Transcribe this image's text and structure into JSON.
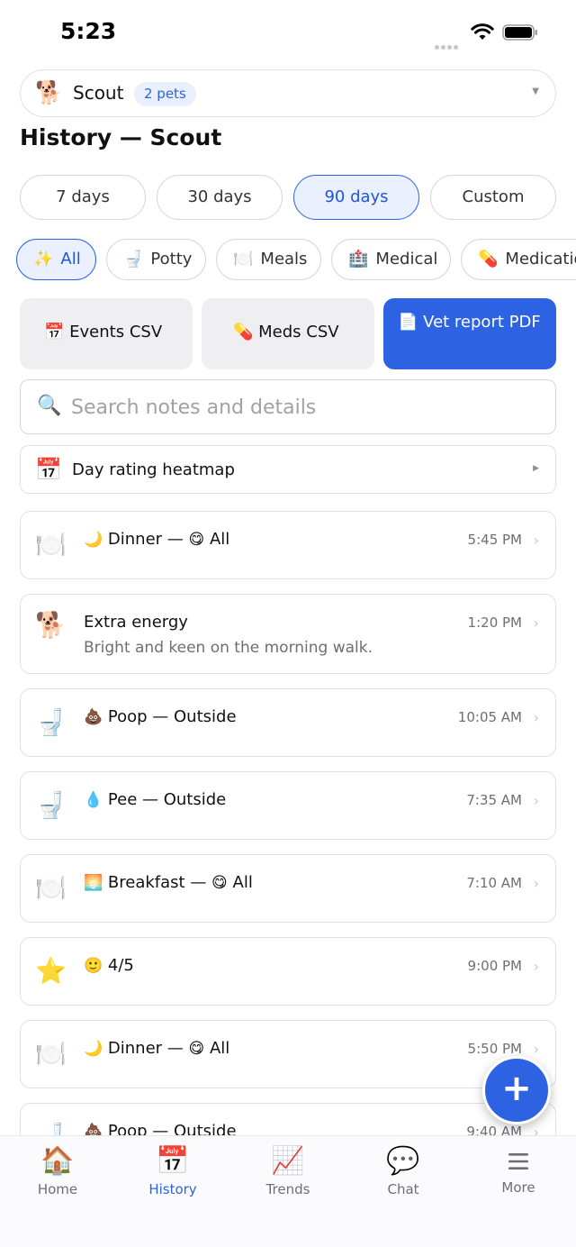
{
  "status": {
    "time": "5:23"
  },
  "pet_selector": {
    "avatar": "🐕",
    "name": "Scout",
    "badge": "2 pets"
  },
  "page_title": "History — Scout",
  "ranges": [
    {
      "label": "7 days",
      "active": false
    },
    {
      "label": "30 days",
      "active": false
    },
    {
      "label": "90 days",
      "active": true
    },
    {
      "label": "Custom",
      "active": false
    }
  ],
  "filters": [
    {
      "icon": "✨",
      "label": "All",
      "active": true
    },
    {
      "icon": "🚽",
      "label": "Potty",
      "active": false
    },
    {
      "icon": "🍽️",
      "label": "Meals",
      "active": false
    },
    {
      "icon": "🏥",
      "label": "Medical",
      "active": false
    },
    {
      "icon": "💊",
      "label": "Medication",
      "active": false
    }
  ],
  "exports": [
    {
      "icon": "📅",
      "label": "Events CSV"
    },
    {
      "icon": "💊",
      "label": "Meds CSV"
    },
    {
      "icon": "📄",
      "label": "Vet report PDF"
    }
  ],
  "search": {
    "placeholder": "Search notes and details",
    "value": ""
  },
  "heatmap": {
    "icon": "📅",
    "label": "Day rating heatmap"
  },
  "events": [
    {
      "icon": "🍽️",
      "emoji": "🌙",
      "title": "Dinner — ",
      "mood": "😋",
      "suffix": " All",
      "time": "5:45 PM"
    },
    {
      "icon": "🐕",
      "emoji": "",
      "title": "Extra energy",
      "mood": "",
      "suffix": "",
      "subtitle": "Bright and keen on the morning walk.",
      "time": "1:20 PM"
    },
    {
      "icon": "🚽",
      "emoji": "💩",
      "title": "Poop — Outside",
      "mood": "",
      "suffix": "",
      "time": "10:05 AM"
    },
    {
      "icon": "🚽",
      "emoji": "💧",
      "title": "Pee — Outside",
      "mood": "",
      "suffix": "",
      "time": "7:35 AM"
    },
    {
      "icon": "🍽️",
      "emoji": "🌅",
      "title": "Breakfast — ",
      "mood": "😋",
      "suffix": " All",
      "time": "7:10 AM"
    },
    {
      "icon": "⭐",
      "emoji": "🙂",
      "title": "4/5",
      "mood": "",
      "suffix": "",
      "time": "9:00 PM"
    },
    {
      "icon": "🍽️",
      "emoji": "🌙",
      "title": "Dinner — ",
      "mood": "😋",
      "suffix": " All",
      "time": "5:50 PM"
    },
    {
      "icon": "🚽",
      "emoji": "💩",
      "title": "Poop — Outside",
      "mood": "",
      "suffix": "",
      "time": "9:40 AM"
    }
  ],
  "fab": {
    "label": "+"
  },
  "tabs": [
    {
      "icon": "🏠",
      "label": "Home",
      "active": false
    },
    {
      "icon": "📅",
      "label": "History",
      "active": true
    },
    {
      "icon": "📈",
      "label": "Trends",
      "active": false
    },
    {
      "icon": "💬",
      "label": "Chat",
      "active": false
    },
    {
      "icon": "≡",
      "label": "More",
      "active": false
    }
  ],
  "colors": {
    "accent": "#2d63e2",
    "accent_light": "#eaf0fd"
  }
}
